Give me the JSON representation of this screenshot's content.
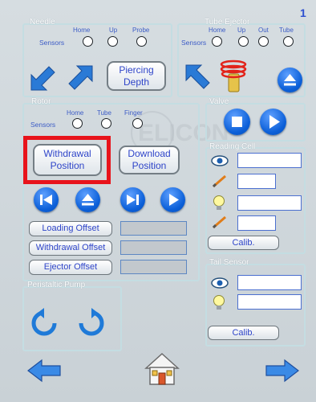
{
  "page_number": "1",
  "needle": {
    "title": "Needle",
    "sensors_label": "Sensors",
    "sensors": [
      "Home",
      "Up",
      "Probe"
    ],
    "piercing_button": [
      "Piercing",
      "Depth"
    ]
  },
  "tube_ejector": {
    "title": "Tube Ejector",
    "sensors_label": "Sensors",
    "sensors": [
      "Home",
      "Up",
      "Out",
      "Tube"
    ]
  },
  "rotor": {
    "title": "Rotor",
    "sensors_label": "Sensors",
    "sensors": [
      "Home",
      "Tube",
      "Finger"
    ],
    "withdrawal_button": [
      "Withdrawal",
      "Position"
    ],
    "download_button": [
      "Download",
      "Position"
    ],
    "offsets": [
      "Loading Offset",
      "Withdrawal Offset",
      "Ejector Offset"
    ]
  },
  "valve": {
    "title": "Valve"
  },
  "reading_cell": {
    "title": "Reading Cell",
    "calib_label": "Calib."
  },
  "tail_sensor": {
    "title": "Tail Sensor",
    "calib_label": "Calib."
  },
  "peristaltic_pump": {
    "title": "Peristaltic Pump"
  },
  "watermark": "ELICON",
  "icons": {
    "needle_left": "blue-arrow-down-left-icon",
    "needle_right": "blue-arrow-up-right-icon",
    "ejector_back": "blue-arrow-up-left-icon",
    "spring": "spring-tube-icon",
    "eject": "eject-icon",
    "stop": "stop-icon",
    "play": "play-icon",
    "eye": "eye-icon",
    "pencil": "pencil-icon",
    "bulb": "lightbulb-icon",
    "pump_ccw": "rotate-counterclockwise-icon",
    "pump_cw": "rotate-clockwise-icon",
    "home": "home-icon",
    "back": "arrow-left-icon",
    "forward": "arrow-right-icon"
  },
  "colors": {
    "accent_blue": "#0b5fd8",
    "highlight_red": "#e8131b",
    "label_blue": "#2f45c9"
  }
}
